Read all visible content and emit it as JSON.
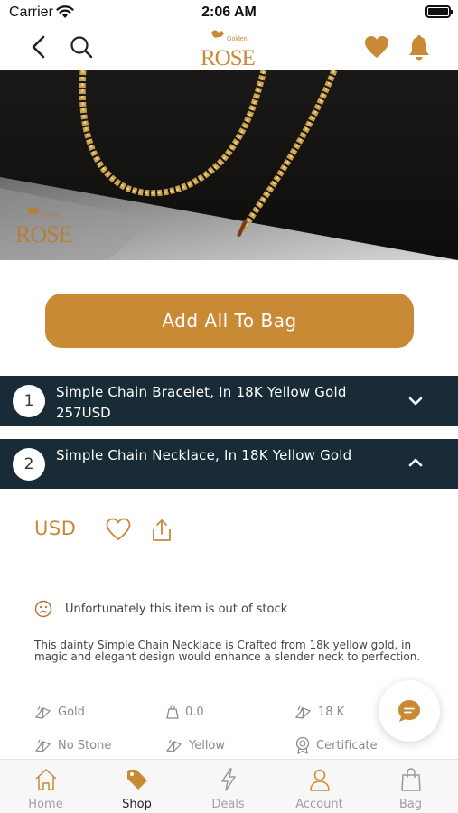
{
  "status_bar": {
    "carrier": "Carrier",
    "time": "2:06 AM"
  },
  "nav": {
    "logo_small": "Golden",
    "logo_main": "ROSE"
  },
  "hero": {
    "watermark_small": "Golden",
    "watermark_main": "ROSE"
  },
  "add_all_label": "Add All To Bag",
  "items": [
    {
      "number": "1",
      "title": "Simple Chain Bracelet, In 18K Yellow Gold",
      "price": "257USD",
      "expanded": false
    },
    {
      "number": "2",
      "title": "Simple Chain Necklace, In 18K Yellow Gold",
      "expanded": true
    }
  ],
  "detail": {
    "currency": "USD",
    "stock_message": "Unfortunately this item is out of stock",
    "description": "This dainty Simple Chain Necklace is Crafted from 18k yellow gold, in magic and elegant design would enhance a slender neck to perfection.",
    "attributes": {
      "metal": "Gold",
      "weight": "0.0",
      "karat": "18 K",
      "stone": "No Stone",
      "color": "Yellow",
      "certificate": "Certificate"
    }
  },
  "tabs": [
    {
      "label": "Home",
      "icon": "home-icon",
      "active": false
    },
    {
      "label": "Shop",
      "icon": "tag-icon",
      "active": true
    },
    {
      "label": "Deals",
      "icon": "lightning-icon",
      "active": false
    },
    {
      "label": "Account",
      "icon": "person-icon",
      "active": false
    },
    {
      "label": "Bag",
      "icon": "bag-icon",
      "active": false
    }
  ],
  "colors": {
    "accent": "#c98a36",
    "dark_bar": "#182b36",
    "active_tab": "#c98a36"
  }
}
